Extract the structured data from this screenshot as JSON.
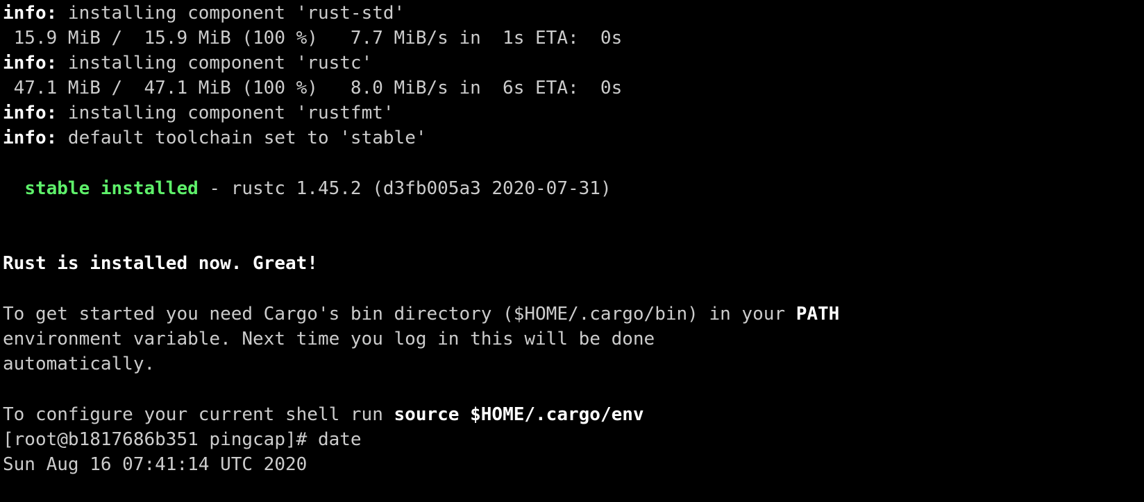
{
  "colors": {
    "background": "#000000",
    "text": "#cccccc",
    "bold": "#ffffff",
    "success": "#5ef06a"
  },
  "lines": {
    "l1_prefix": "info:",
    "l1_text": " installing component 'rust-std'",
    "l2_text": " 15.9 MiB /  15.9 MiB (100 %)   7.7 MiB/s in  1s ETA:  0s",
    "l3_prefix": "info:",
    "l3_text": " installing component 'rustc'",
    "l4_text": " 47.1 MiB /  47.1 MiB (100 %)   8.0 MiB/s in  6s ETA:  0s",
    "l5_prefix": "info:",
    "l5_text": " installing component 'rustfmt'",
    "l6_prefix": "info:",
    "l6_text": " default toolchain set to 'stable'",
    "l7_indent": "  ",
    "l7_status": "stable installed",
    "l7_text": " - rustc 1.45.2 (d3fb005a3 2020-07-31)",
    "l8_text": "Rust is installed now. Great!",
    "l9_text": "To get started you need Cargo's bin directory ($HOME/.cargo/bin) in your ",
    "l9_bold": "PATH",
    "l10_text": "environment variable. Next time you log in this will be done",
    "l11_text": "automatically.",
    "l12_text": "To configure your current shell run ",
    "l12_bold": "source $HOME/.cargo/env",
    "l13_text": "[root@b1817686b351 pingcap]# date",
    "l14_text": "Sun Aug 16 07:41:14 UTC 2020"
  }
}
